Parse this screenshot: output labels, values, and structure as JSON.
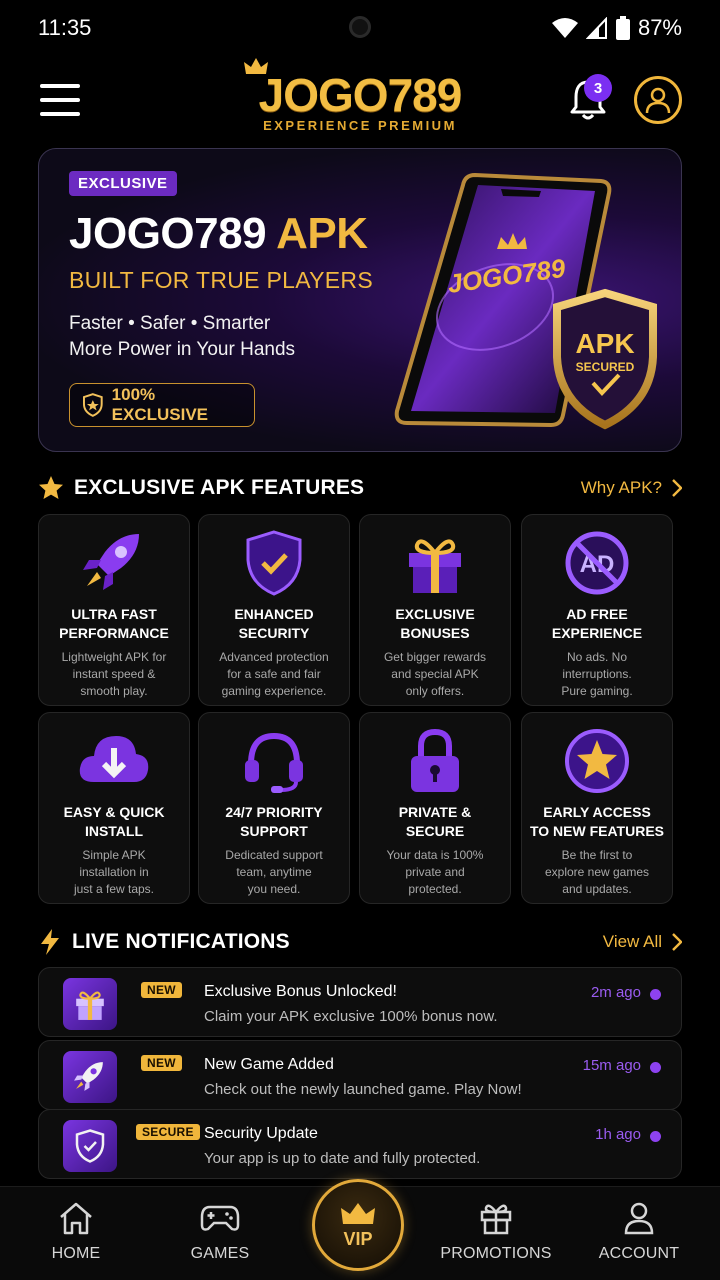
{
  "status_bar": {
    "time": "11:35",
    "battery": "87%"
  },
  "header": {
    "logo_text": "JOGO789",
    "logo_subtitle": "EXPERIENCE PREMIUM",
    "notification_count": "3"
  },
  "hero": {
    "tag": "EXCLUSIVE",
    "title_white": "JOGO789",
    "title_gold": "APK",
    "subtitle": "BUILT FOR TRUE PLAYERS",
    "desc_line1": "Faster • Safer • Smarter",
    "desc_line2": "More Power in Your Hands",
    "button_label": "100% EXCLUSIVE",
    "phone_logo": "JOGO789",
    "shield_title": "APK",
    "shield_sub": "SECURED"
  },
  "features_section": {
    "title": "EXCLUSIVE APK FEATURES",
    "link": "Why APK?",
    "items": [
      {
        "icon": "rocket-icon",
        "title": "ULTRA FAST\nPERFORMANCE",
        "desc": "Lightweight APK for\ninstant speed &\nsmooth play."
      },
      {
        "icon": "shield-check-icon",
        "title": "ENHANCED\nSECURITY",
        "desc": "Advanced protection\nfor a safe and fair\ngaming experience."
      },
      {
        "icon": "gift-icon",
        "title": "EXCLUSIVE\nBONUSES",
        "desc": "Get bigger rewards\nand special APK\nonly offers."
      },
      {
        "icon": "no-ads-icon",
        "title": "AD FREE\nEXPERIENCE",
        "desc": "No ads. No\ninterruptions.\nPure gaming."
      },
      {
        "icon": "cloud-download-icon",
        "title": "EASY & QUICK\nINSTALL",
        "desc": "Simple APK\ninstallation in\njust a few taps."
      },
      {
        "icon": "headset-icon",
        "title": "24/7 PRIORITY\nSUPPORT",
        "desc": "Dedicated support\nteam, anytime\nyou need."
      },
      {
        "icon": "lock-icon",
        "title": "PRIVATE &\nSECURE",
        "desc": "Your data is 100%\nprivate and\nprotected."
      },
      {
        "icon": "star-badge-icon",
        "title": "EARLY ACCESS\nTO NEW FEATURES",
        "desc": "Be the first to\nexplore new games\nand updates."
      }
    ]
  },
  "notifications_section": {
    "title": "LIVE NOTIFICATIONS",
    "link": "View All",
    "items": [
      {
        "icon": "gift-icon",
        "tag": "NEW",
        "title": "Exclusive Bonus Unlocked!",
        "desc": "Claim your APK exclusive 100% bonus now.",
        "time": "2m ago"
      },
      {
        "icon": "rocket-icon",
        "tag": "NEW",
        "title": "New Game Added",
        "desc": "Check out the newly launched game. Play Now!",
        "time": "15m ago"
      },
      {
        "icon": "shield-check-icon",
        "tag": "SECURE",
        "title": "Security Update",
        "desc": "Your app is up to date and fully protected.",
        "time": "1h ago"
      }
    ]
  },
  "bottom_nav": {
    "home": "HOME",
    "games": "GAMES",
    "vip": "VIP",
    "promotions": "PROMOTIONS",
    "account": "ACCOUNT"
  },
  "colors": {
    "gold": "#f2b941",
    "purple": "#7b2ff2",
    "background": "#000000"
  }
}
